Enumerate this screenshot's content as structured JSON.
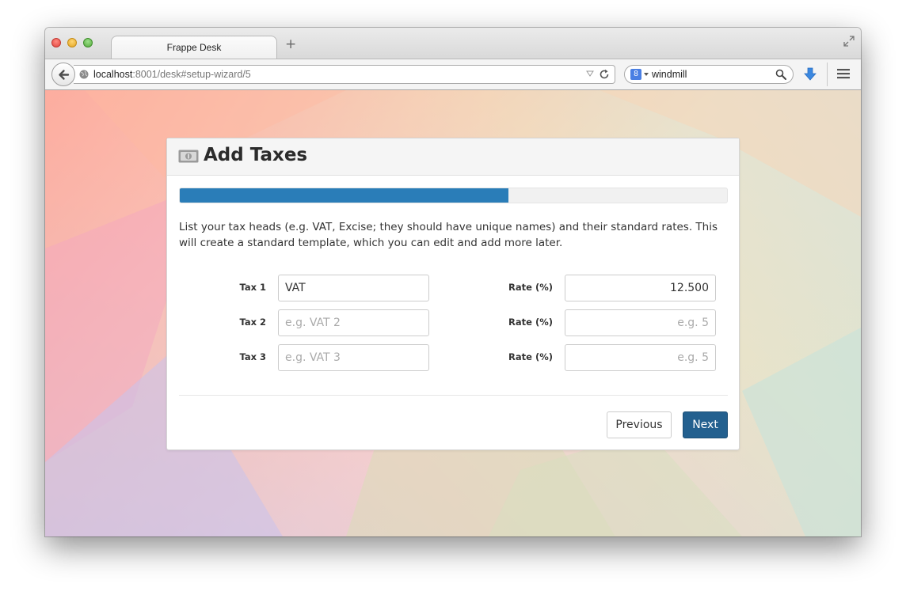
{
  "browser": {
    "tab_title": "Frappe Desk",
    "new_tab_label": "+",
    "url_host": "localhost",
    "url_rest": ":8001/desk#setup-wizard/5",
    "search_query": "windmill",
    "search_engine_letter": "8"
  },
  "wizard": {
    "title": "Add Taxes",
    "progress_fraction": 0.6,
    "intro": "List your tax heads (e.g. VAT, Excise; they should have unique names) and their standard rates. This will create a standard template, which you can edit and add more later.",
    "rows": [
      {
        "tax_label": "Tax 1",
        "tax_value": "VAT",
        "tax_placeholder": "",
        "rate_label": "Rate (%)",
        "rate_value": "12.500",
        "rate_placeholder": ""
      },
      {
        "tax_label": "Tax 2",
        "tax_value": "",
        "tax_placeholder": "e.g. VAT 2",
        "rate_label": "Rate (%)",
        "rate_value": "",
        "rate_placeholder": "e.g. 5"
      },
      {
        "tax_label": "Tax 3",
        "tax_value": "",
        "tax_placeholder": "e.g. VAT 3",
        "rate_label": "Rate (%)",
        "rate_value": "",
        "rate_placeholder": "e.g. 5"
      }
    ],
    "previous_label": "Previous",
    "next_label": "Next"
  },
  "colors": {
    "primary": "#23608f",
    "progress": "#2a7db8"
  }
}
